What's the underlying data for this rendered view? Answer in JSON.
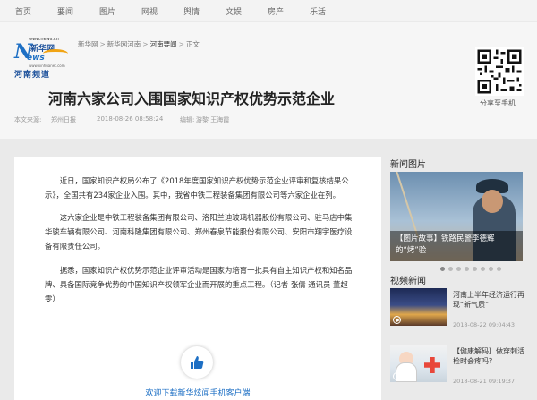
{
  "nav": [
    "首页",
    "要闻",
    "图片",
    "网视",
    "舆情",
    "文娱",
    "房产",
    "乐活"
  ],
  "logo": {
    "url_top": "www.news.cn",
    "n": "N",
    "ews": "ews",
    "brand": "新华网",
    "url_bottom": "www.xinhuanet.com",
    "region": "河南频道"
  },
  "breadcrumb": {
    "items": [
      "新华网",
      "新华网河南",
      "河南要闻",
      "正文"
    ],
    "separator": ">"
  },
  "qr_label": "分享至手机",
  "article": {
    "title": "河南六家公司入围国家知识产权优势示范企业",
    "source_label": "本文来源:",
    "source": "郑州日报",
    "datetime": "2018-08-26 08:58:24",
    "editor_label": "编辑:",
    "editor": "游黎 王海霞",
    "paragraphs": [
      "近日，国家知识产权局公布了《2018年度国家知识产权优势示范企业评审和复核结果公示》，全国共有234家企业入围。其中，我省中铁工程装备集团有限公司等六家企业在列。",
      "这六家企业是中铁工程装备集团有限公司、洛阳兰迪玻璃机器股份有限公司、驻马店中集华骏车辆有限公司、河南科隆集团有限公司、郑州春泉节能股份有限公司、安阳市翔宇医疗设备有限责任公司。",
      "据悉，国家知识产权优势示范企业评审活动是国家为培育一批具有自主知识产权和知名品牌、具备国际竞争优势的中国知识产权领军企业而开展的重点工程。（记者 张倩 通讯员 董超雯）"
    ],
    "download_text": "欢迎下载新华炫闻手机客户端"
  },
  "sidebar": {
    "news_pictures_title": "新闻图片",
    "feature_caption": "【图片故事】铁路民警李德辉的“烤”验",
    "dots_count": 8,
    "dots_active": 0,
    "video_title": "视频新闻",
    "videos": [
      {
        "title": "河南上半年经济运行再现“新气质”",
        "date": "2018-08-22 09:04:43"
      },
      {
        "title": "【健康解码】做穿刺活检时会疼吗？",
        "date": "2018-08-21 09:19:37"
      }
    ]
  },
  "colors": {
    "link_blue": "#1d6fc4",
    "logo_orange": "#f1a414",
    "page_bg": "#eaeaea"
  }
}
